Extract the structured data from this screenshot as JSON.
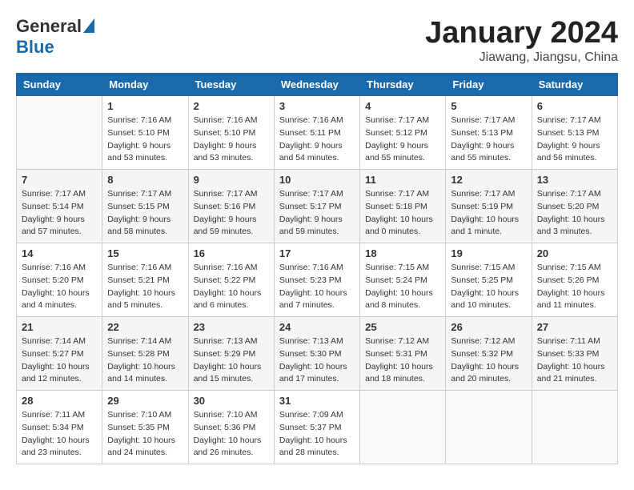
{
  "header": {
    "logo_general": "General",
    "logo_blue": "Blue",
    "title": "January 2024",
    "subtitle": "Jiawang, Jiangsu, China"
  },
  "weekdays": [
    "Sunday",
    "Monday",
    "Tuesday",
    "Wednesday",
    "Thursday",
    "Friday",
    "Saturday"
  ],
  "weeks": [
    [
      {
        "day": "",
        "sunrise": "",
        "sunset": "",
        "daylight": ""
      },
      {
        "day": "1",
        "sunrise": "Sunrise: 7:16 AM",
        "sunset": "Sunset: 5:10 PM",
        "daylight": "Daylight: 9 hours and 53 minutes."
      },
      {
        "day": "2",
        "sunrise": "Sunrise: 7:16 AM",
        "sunset": "Sunset: 5:10 PM",
        "daylight": "Daylight: 9 hours and 53 minutes."
      },
      {
        "day": "3",
        "sunrise": "Sunrise: 7:16 AM",
        "sunset": "Sunset: 5:11 PM",
        "daylight": "Daylight: 9 hours and 54 minutes."
      },
      {
        "day": "4",
        "sunrise": "Sunrise: 7:17 AM",
        "sunset": "Sunset: 5:12 PM",
        "daylight": "Daylight: 9 hours and 55 minutes."
      },
      {
        "day": "5",
        "sunrise": "Sunrise: 7:17 AM",
        "sunset": "Sunset: 5:13 PM",
        "daylight": "Daylight: 9 hours and 55 minutes."
      },
      {
        "day": "6",
        "sunrise": "Sunrise: 7:17 AM",
        "sunset": "Sunset: 5:13 PM",
        "daylight": "Daylight: 9 hours and 56 minutes."
      }
    ],
    [
      {
        "day": "7",
        "sunrise": "Sunrise: 7:17 AM",
        "sunset": "Sunset: 5:14 PM",
        "daylight": "Daylight: 9 hours and 57 minutes."
      },
      {
        "day": "8",
        "sunrise": "Sunrise: 7:17 AM",
        "sunset": "Sunset: 5:15 PM",
        "daylight": "Daylight: 9 hours and 58 minutes."
      },
      {
        "day": "9",
        "sunrise": "Sunrise: 7:17 AM",
        "sunset": "Sunset: 5:16 PM",
        "daylight": "Daylight: 9 hours and 59 minutes."
      },
      {
        "day": "10",
        "sunrise": "Sunrise: 7:17 AM",
        "sunset": "Sunset: 5:17 PM",
        "daylight": "Daylight: 9 hours and 59 minutes."
      },
      {
        "day": "11",
        "sunrise": "Sunrise: 7:17 AM",
        "sunset": "Sunset: 5:18 PM",
        "daylight": "Daylight: 10 hours and 0 minutes."
      },
      {
        "day": "12",
        "sunrise": "Sunrise: 7:17 AM",
        "sunset": "Sunset: 5:19 PM",
        "daylight": "Daylight: 10 hours and 1 minute."
      },
      {
        "day": "13",
        "sunrise": "Sunrise: 7:17 AM",
        "sunset": "Sunset: 5:20 PM",
        "daylight": "Daylight: 10 hours and 3 minutes."
      }
    ],
    [
      {
        "day": "14",
        "sunrise": "Sunrise: 7:16 AM",
        "sunset": "Sunset: 5:20 PM",
        "daylight": "Daylight: 10 hours and 4 minutes."
      },
      {
        "day": "15",
        "sunrise": "Sunrise: 7:16 AM",
        "sunset": "Sunset: 5:21 PM",
        "daylight": "Daylight: 10 hours and 5 minutes."
      },
      {
        "day": "16",
        "sunrise": "Sunrise: 7:16 AM",
        "sunset": "Sunset: 5:22 PM",
        "daylight": "Daylight: 10 hours and 6 minutes."
      },
      {
        "day": "17",
        "sunrise": "Sunrise: 7:16 AM",
        "sunset": "Sunset: 5:23 PM",
        "daylight": "Daylight: 10 hours and 7 minutes."
      },
      {
        "day": "18",
        "sunrise": "Sunrise: 7:15 AM",
        "sunset": "Sunset: 5:24 PM",
        "daylight": "Daylight: 10 hours and 8 minutes."
      },
      {
        "day": "19",
        "sunrise": "Sunrise: 7:15 AM",
        "sunset": "Sunset: 5:25 PM",
        "daylight": "Daylight: 10 hours and 10 minutes."
      },
      {
        "day": "20",
        "sunrise": "Sunrise: 7:15 AM",
        "sunset": "Sunset: 5:26 PM",
        "daylight": "Daylight: 10 hours and 11 minutes."
      }
    ],
    [
      {
        "day": "21",
        "sunrise": "Sunrise: 7:14 AM",
        "sunset": "Sunset: 5:27 PM",
        "daylight": "Daylight: 10 hours and 12 minutes."
      },
      {
        "day": "22",
        "sunrise": "Sunrise: 7:14 AM",
        "sunset": "Sunset: 5:28 PM",
        "daylight": "Daylight: 10 hours and 14 minutes."
      },
      {
        "day": "23",
        "sunrise": "Sunrise: 7:13 AM",
        "sunset": "Sunset: 5:29 PM",
        "daylight": "Daylight: 10 hours and 15 minutes."
      },
      {
        "day": "24",
        "sunrise": "Sunrise: 7:13 AM",
        "sunset": "Sunset: 5:30 PM",
        "daylight": "Daylight: 10 hours and 17 minutes."
      },
      {
        "day": "25",
        "sunrise": "Sunrise: 7:12 AM",
        "sunset": "Sunset: 5:31 PM",
        "daylight": "Daylight: 10 hours and 18 minutes."
      },
      {
        "day": "26",
        "sunrise": "Sunrise: 7:12 AM",
        "sunset": "Sunset: 5:32 PM",
        "daylight": "Daylight: 10 hours and 20 minutes."
      },
      {
        "day": "27",
        "sunrise": "Sunrise: 7:11 AM",
        "sunset": "Sunset: 5:33 PM",
        "daylight": "Daylight: 10 hours and 21 minutes."
      }
    ],
    [
      {
        "day": "28",
        "sunrise": "Sunrise: 7:11 AM",
        "sunset": "Sunset: 5:34 PM",
        "daylight": "Daylight: 10 hours and 23 minutes."
      },
      {
        "day": "29",
        "sunrise": "Sunrise: 7:10 AM",
        "sunset": "Sunset: 5:35 PM",
        "daylight": "Daylight: 10 hours and 24 minutes."
      },
      {
        "day": "30",
        "sunrise": "Sunrise: 7:10 AM",
        "sunset": "Sunset: 5:36 PM",
        "daylight": "Daylight: 10 hours and 26 minutes."
      },
      {
        "day": "31",
        "sunrise": "Sunrise: 7:09 AM",
        "sunset": "Sunset: 5:37 PM",
        "daylight": "Daylight: 10 hours and 28 minutes."
      },
      {
        "day": "",
        "sunrise": "",
        "sunset": "",
        "daylight": ""
      },
      {
        "day": "",
        "sunrise": "",
        "sunset": "",
        "daylight": ""
      },
      {
        "day": "",
        "sunrise": "",
        "sunset": "",
        "daylight": ""
      }
    ]
  ]
}
